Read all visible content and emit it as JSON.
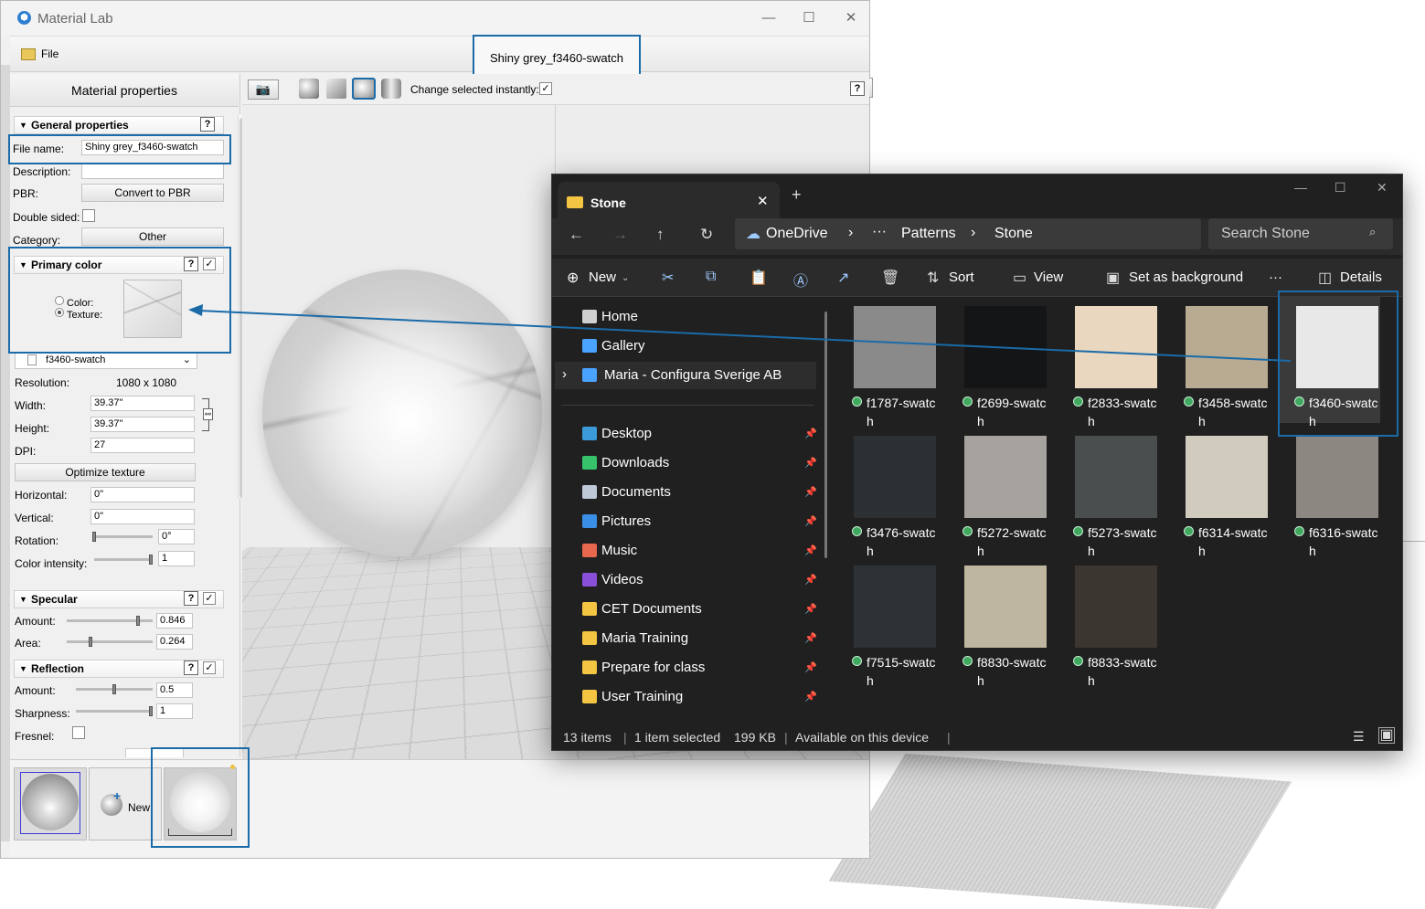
{
  "material_lab": {
    "title": "Material Lab",
    "menu_file": "File",
    "document_name": "Shiny grey_f3460-swatch",
    "left_panel": {
      "header": "Material properties",
      "general": {
        "title": "General properties",
        "help": "?",
        "file_name_label": "File name:",
        "file_name_value": "Shiny grey_f3460-swatch",
        "description_label": "Description:",
        "description_value": "",
        "pbr_label": "PBR:",
        "convert_button": "Convert to PBR",
        "double_sided_label": "Double sided:",
        "category_label": "Category:",
        "category_value": "Other"
      },
      "primary_color": {
        "title": "Primary color",
        "help": "?",
        "check": "✓",
        "color_label": "Color:",
        "texture_label": "Texture:",
        "texture_select": "f3460-swatch",
        "resolution_label": "Resolution:",
        "resolution_value": "1080 x 1080",
        "width_label": "Width:",
        "width_value": "39.37\"",
        "height_label": "Height:",
        "height_value": "39.37\"",
        "dpi_label": "DPI:",
        "dpi_value": "27",
        "optimize_button": "Optimize texture",
        "horizontal_label": "Horizontal:",
        "horizontal_value": "0\"",
        "vertical_label": "Vertical:",
        "vertical_value": "0\"",
        "rotation_label": "Rotation:",
        "rotation_value": "0°",
        "rotation_level": 0,
        "intensity_label": "Color intensity:",
        "intensity_value": "1",
        "intensity_level": 1.0
      },
      "specular": {
        "title": "Specular",
        "help": "?",
        "check": "✓",
        "amount_label": "Amount:",
        "amount_value": "0.846",
        "amount_level": 0.846,
        "area_label": "Area:",
        "area_value": "0.264",
        "area_level": 0.264
      },
      "reflection": {
        "title": "Reflection",
        "help": "?",
        "check": "✓",
        "amount_label": "Amount:",
        "amount_value": "0.5",
        "amount_level": 0.5,
        "sharpness_label": "Sharpness:",
        "sharpness_value": "1",
        "sharpness_level": 1.0,
        "fresnel_label": "Fresnel:"
      }
    },
    "viewport_toolbar": {
      "change_instantly_label": "Change selected instantly:",
      "change_instantly_check": "✓",
      "help": "?"
    },
    "bottom_strip": {
      "new_label": "New"
    }
  },
  "explorer": {
    "tab_title": "Stone",
    "tab_close": "✕",
    "new_tab": "+",
    "breadcrumb": [
      "OneDrive",
      "···",
      "Patterns",
      "Stone"
    ],
    "search_placeholder": "Search Stone",
    "commands": {
      "new": "New",
      "sort": "Sort",
      "view": "View",
      "set_background": "Set as background",
      "more": "···",
      "details": "Details"
    },
    "nav_items": [
      {
        "label": "Home",
        "icon": "home-icon",
        "pinned": false
      },
      {
        "label": "Gallery",
        "icon": "gallery-icon",
        "pinned": false
      },
      {
        "label": "Maria - Configura Sverige AB",
        "icon": "onedrive-icon",
        "pinned": false
      },
      {
        "label": "Desktop",
        "icon": "desktop-icon",
        "pinned": true
      },
      {
        "label": "Downloads",
        "icon": "downloads-icon",
        "pinned": true
      },
      {
        "label": "Documents",
        "icon": "documents-icon",
        "pinned": true
      },
      {
        "label": "Pictures",
        "icon": "pictures-icon",
        "pinned": true
      },
      {
        "label": "Music",
        "icon": "music-icon",
        "pinned": true
      },
      {
        "label": "Videos",
        "icon": "videos-icon",
        "pinned": true
      },
      {
        "label": "CET Documents",
        "icon": "folder-icon",
        "pinned": true
      },
      {
        "label": "Maria Training",
        "icon": "folder-icon",
        "pinned": true
      },
      {
        "label": "Prepare for class",
        "icon": "folder-icon",
        "pinned": true
      },
      {
        "label": "User Training",
        "icon": "folder-icon",
        "pinned": true
      }
    ],
    "files": [
      {
        "name_line1": "f1787-swatc",
        "name_line2": "h",
        "color": "#8a8a8a"
      },
      {
        "name_line1": "f2699-swatc",
        "name_line2": "h",
        "color": "#141517"
      },
      {
        "name_line1": "f2833-swatc",
        "name_line2": "h",
        "color": "#e9d7bf"
      },
      {
        "name_line1": "f3458-swatc",
        "name_line2": "h",
        "color": "#b9aa92"
      },
      {
        "name_line1": "f3460-swatc",
        "name_line2": "h",
        "color": "#e8e8e8"
      },
      {
        "name_line1": "f3476-swatc",
        "name_line2": "h",
        "color": "#2d3032"
      },
      {
        "name_line1": "f5272-swatc",
        "name_line2": "h",
        "color": "#a6a39e"
      },
      {
        "name_line1": "f5273-swatc",
        "name_line2": "h",
        "color": "#4b4e4f"
      },
      {
        "name_line1": "f6314-swatc",
        "name_line2": "h",
        "color": "#d1cbbd"
      },
      {
        "name_line1": "f6316-swatc",
        "name_line2": "h",
        "color": "#8d8781"
      },
      {
        "name_line1": "f7515-swatc",
        "name_line2": "h",
        "color": "#2e3236"
      },
      {
        "name_line1": "f8830-swatc",
        "name_line2": "h",
        "color": "#bfb69f"
      },
      {
        "name_line1": "f8833-swatc",
        "name_line2": "h",
        "color": "#3c3631"
      }
    ],
    "status": {
      "count": "13 items",
      "selected": "1 item selected",
      "size": "199 KB",
      "availability": "Available on this device"
    }
  },
  "colors": {
    "highlight": "#1a6ba8",
    "explorer_bg": "#202020",
    "sync_ok": "#41a85f"
  }
}
